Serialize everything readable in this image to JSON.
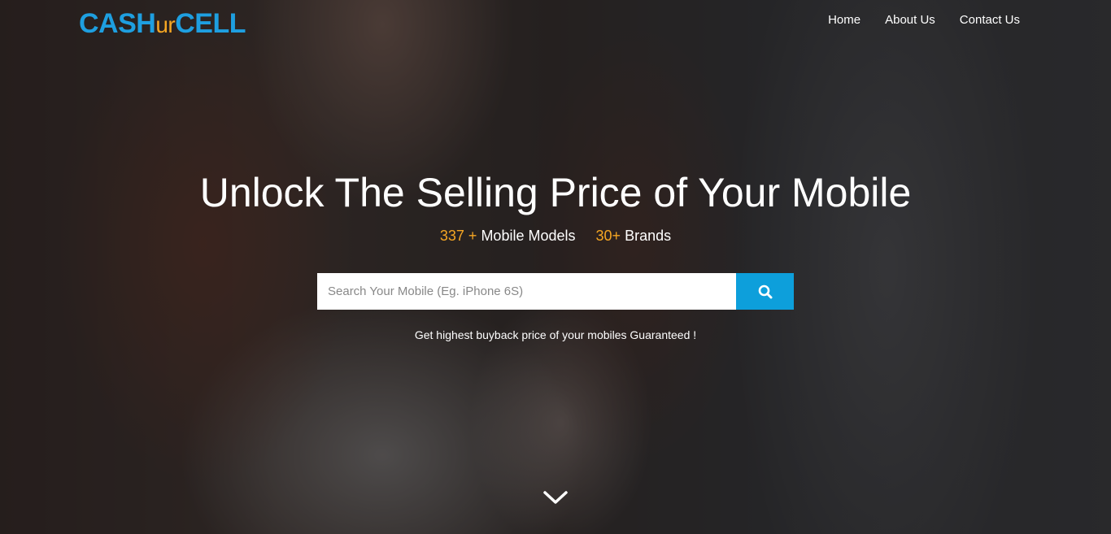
{
  "brand": {
    "part1": "CASH",
    "part2": "ur",
    "part3": "CELL"
  },
  "nav": {
    "items": [
      {
        "label": "Home"
      },
      {
        "label": "About Us"
      },
      {
        "label": "Contact Us"
      }
    ]
  },
  "hero": {
    "headline": "Unlock The Selling Price of Your Mobile",
    "stats": {
      "models_count": "337 +",
      "models_label": "Mobile Models",
      "brands_count": "30+",
      "brands_label": "Brands"
    },
    "search": {
      "placeholder": "Search Your Mobile (Eg. iPhone 6S)",
      "value": "",
      "icon": "search-icon"
    },
    "tagline": "Get highest buyback price of your mobiles Guaranteed !",
    "scroll_icon": "chevron-down-icon"
  },
  "colors": {
    "brand_blue": "#1e9fe0",
    "brand_orange": "#f5a623",
    "search_button": "#0d9fdb",
    "text_white": "#ffffff"
  }
}
